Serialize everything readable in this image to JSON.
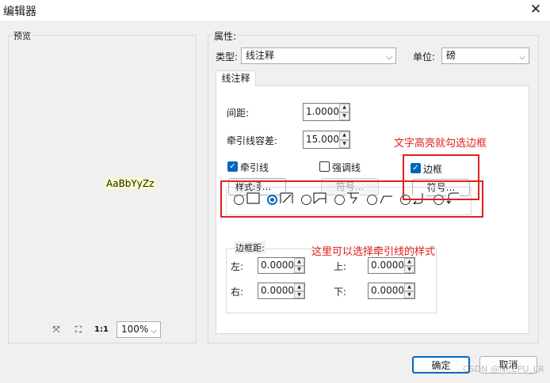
{
  "window": {
    "title": "编辑器"
  },
  "preview": {
    "group_label": "预览",
    "sample_text": "AaBbYyZz",
    "zoom": "100%"
  },
  "properties": {
    "group_label": "属性:",
    "type_label": "类型:",
    "type_value": "线注释",
    "unit_label": "单位:",
    "unit_value": "磅",
    "tab_label": "线注释",
    "spacing_label": "间距:",
    "spacing_value": "1.0000",
    "leader_tol_label": "牵引线容差:",
    "leader_tol_value": "15.0000",
    "leader_label": "牵引线",
    "emphasis_label": "强调线",
    "border_label": "边框",
    "symbol_btn": "符号...",
    "style_label": "样式:",
    "margin_label": "边框距:",
    "left_label": "左:",
    "left_value": "0.0000",
    "top_label": "上:",
    "top_value": "0.0000",
    "right_label": "右:",
    "right_value": "0.0000",
    "bottom_label": "下:",
    "bottom_value": "0.0000"
  },
  "annotations": {
    "border_note": "文字高亮就勾选边框",
    "style_note": "这里可以选择牵引线的样式"
  },
  "footer": {
    "ok": "确定",
    "cancel": "取消",
    "watermark": "CSDN @NCEPU_LR"
  }
}
